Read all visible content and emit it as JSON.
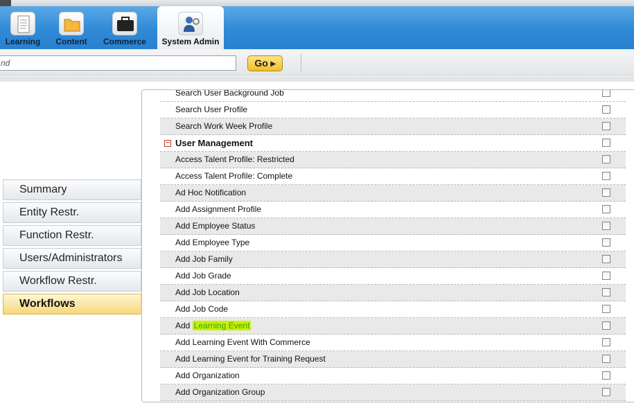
{
  "nav": {
    "tabs": [
      {
        "label": "Learning",
        "icon": "document-icon"
      },
      {
        "label": "Content",
        "icon": "folder-icon"
      },
      {
        "label": "Commerce",
        "icon": "briefcase-icon"
      },
      {
        "label": "System Admin",
        "icon": "admin-user-icon",
        "active": true
      }
    ]
  },
  "search": {
    "value": "nd",
    "go_label": "Go"
  },
  "sidebar": {
    "items": [
      {
        "label": "Summary"
      },
      {
        "label": "Entity Restr."
      },
      {
        "label": "Function Restr."
      },
      {
        "label": "Users/Administrators"
      },
      {
        "label": "Workflow Restr."
      },
      {
        "label": "Workflows",
        "active": true
      }
    ]
  },
  "workflows": {
    "rows": [
      {
        "label": "Search User Background Job",
        "shaded": false
      },
      {
        "label": "Search User Profile",
        "shaded": false
      },
      {
        "label": "Search Work Week Profile",
        "shaded": true
      },
      {
        "label": "User Management",
        "group": true
      },
      {
        "label": "Access Talent Profile: Restricted",
        "shaded": true
      },
      {
        "label": "Access Talent Profile: Complete",
        "shaded": false
      },
      {
        "label": "Ad Hoc Notification",
        "shaded": true
      },
      {
        "label": "Add Assignment Profile",
        "shaded": false
      },
      {
        "label": "Add Employee Status",
        "shaded": true
      },
      {
        "label": "Add Employee Type",
        "shaded": false
      },
      {
        "label": "Add Job Family",
        "shaded": true
      },
      {
        "label": "Add Job Grade",
        "shaded": false
      },
      {
        "label": "Add Job Location",
        "shaded": true
      },
      {
        "label": "Add Job Code",
        "shaded": false
      },
      {
        "label_prefix": "Add ",
        "label_highlight": "Learning Event",
        "shaded": true
      },
      {
        "label": "Add Learning Event With Commerce",
        "shaded": false
      },
      {
        "label": "Add Learning Event for Training Request",
        "shaded": true
      },
      {
        "label": "Add Organization",
        "shaded": false
      },
      {
        "label": "Add Organization Group",
        "shaded": true
      }
    ]
  },
  "colors": {
    "navbar": "#2f8ad6",
    "active_item": "#f6d77a",
    "highlight_bg": "#c9f000",
    "highlight_text": "#2da52d"
  }
}
